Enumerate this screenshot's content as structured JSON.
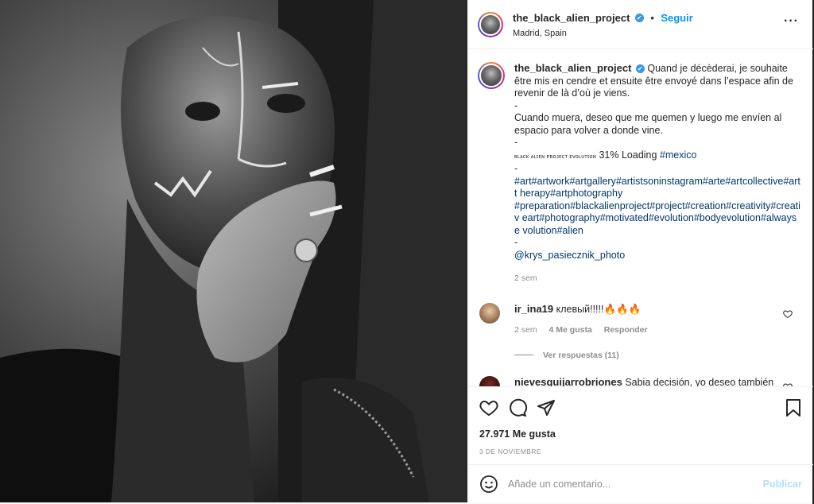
{
  "post": {
    "username": "the_black_alien_project",
    "verified_icon": "verified-badge-icon",
    "follow_label": "Seguir",
    "location": "Madrid, Spain"
  },
  "caption": {
    "username": "the_black_alien_project",
    "text_fr": "Quand je décèderai, je souhaite être mis en cendre et ensuite être envoyé dans l’espace afin de revenir de là d’où je viens.",
    "sep1": "-",
    "text_es": "Cuando muera, deseo que me quemen y luego me envíen al espacio para volver a donde vine.",
    "sep2": "-",
    "loading_prefix": "ʙʟᴀᴄᴋ ᴀʟɪᴇɴ ᴘʀᴏᴊᴇᴄᴛ ᴇᴠᴏʟᴜᴛɪᴏɴ",
    "loading_text": " 31% Loading ",
    "loading_tag": "#mexico",
    "sep3": "-",
    "hashtags_1": "#art#artwork#artgallery#artistsoninstagram#arte#artcollective#artt herapy#artphotography",
    "hashtags_2": "#preparation#blackalienproject#project#creation#creativity#creativ eart#photography#motivated#evolution#bodyevolution#alwayse volution#alien",
    "sep4": "-",
    "mention": "@krys_pasiecznik_photo",
    "time": "2 sem"
  },
  "comments": [
    {
      "username": "ir_ina19",
      "text": "клевый!!!!!🔥🔥🔥",
      "time": "2 sem",
      "likes": "4 Me gusta",
      "reply": "Responder",
      "view_replies": "Ver respuestas (11)"
    },
    {
      "username": "nievesguijarrobriones",
      "text": "Sabia decisión, yo deseo también que"
    }
  ],
  "actions": {
    "likes": "27.971 Me gusta",
    "date": "3 DE NOVIEMBRE"
  },
  "add_comment": {
    "placeholder": "Añade un comentario...",
    "publish": "Publicar"
  },
  "colors": {
    "link": "#00376b",
    "accent": "#0095f6",
    "muted": "#8e8e8e",
    "publish_disabled": "#b2dffc"
  }
}
